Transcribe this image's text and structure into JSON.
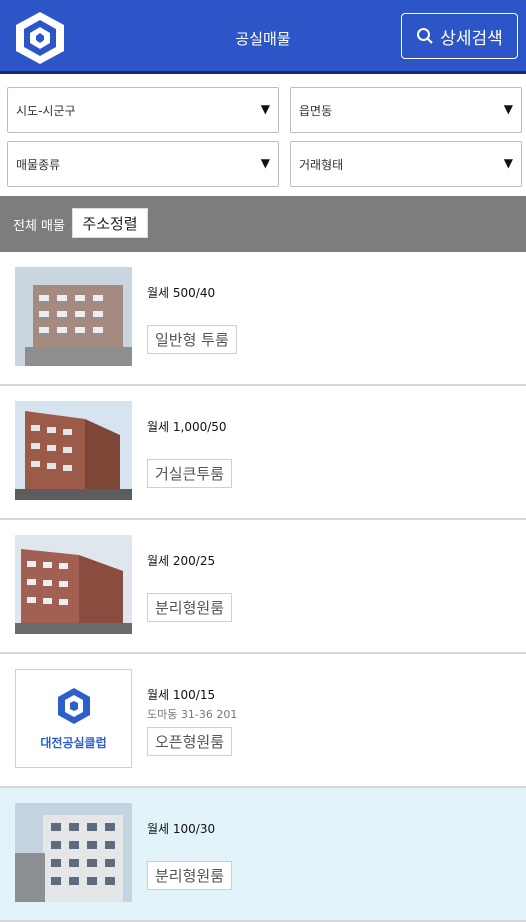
{
  "header": {
    "title": "공실매물",
    "detail_search_label": "상세검색"
  },
  "filters": {
    "sido": "시도-시군구",
    "eup": "읍면동",
    "type": "매물종류",
    "deal": "거래형태"
  },
  "sortbar": {
    "all_label": "전체 매물",
    "sort_label": "주소정렬"
  },
  "listings": [
    {
      "price": "월세 500/40",
      "addr": "",
      "tag": "일반형 투룸"
    },
    {
      "price": "월세 1,000/50",
      "addr": "",
      "tag": "거실큰투룸"
    },
    {
      "price": "월세 200/25",
      "addr": "",
      "tag": "분리형원룸"
    },
    {
      "price": "월세 100/15",
      "addr": "도마동 31-36 201",
      "tag": "오픈형원룸",
      "logo_text": "대전공실클럽"
    },
    {
      "price": "월세 100/30",
      "addr": "",
      "tag": "분리형원룸"
    }
  ],
  "colors": {
    "header": "#2c55c8",
    "sortbar": "#7d7d7d",
    "highlight": "#e3f3fa",
    "brand": "#2c5fc9"
  }
}
